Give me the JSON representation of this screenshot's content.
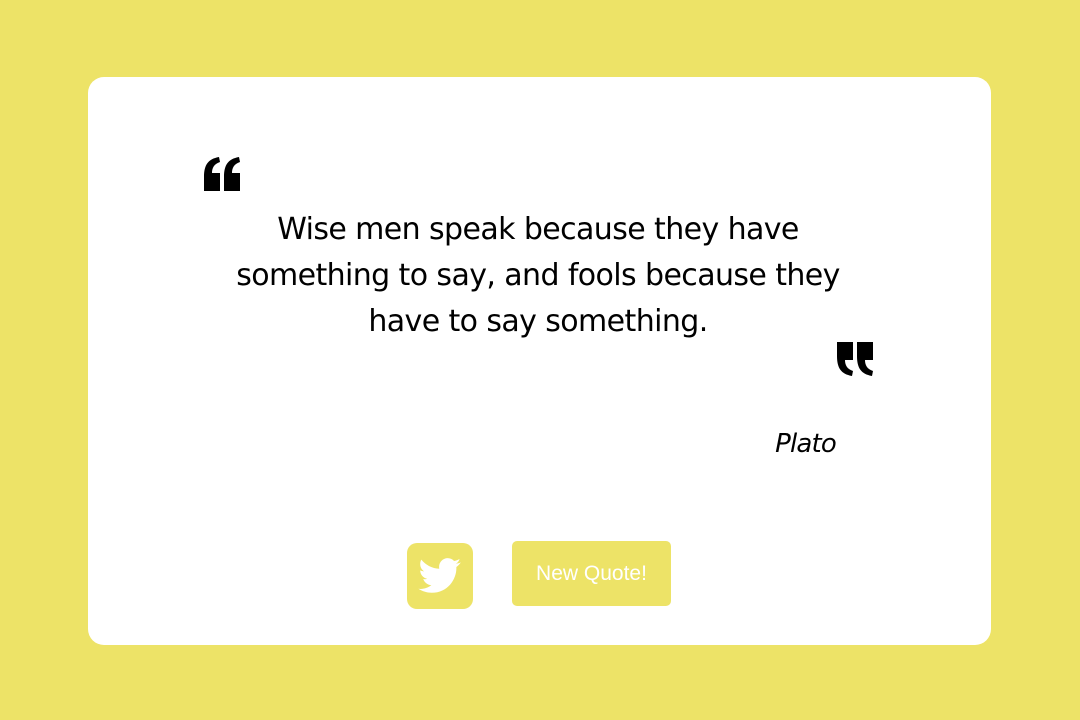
{
  "theme": {
    "background_color": "#ede367",
    "card_color": "#ffffff",
    "text_color": "#000000",
    "button_text_color": "#ffffff"
  },
  "quote": {
    "open_icon": "quote-open-icon",
    "text": "Wise men speak because they have something to say, and fools because they have to say something.",
    "close_icon": "quote-close-icon",
    "author": "Plato"
  },
  "actions": {
    "tweet_icon": "twitter-icon",
    "new_quote_label": "New Quote!"
  }
}
